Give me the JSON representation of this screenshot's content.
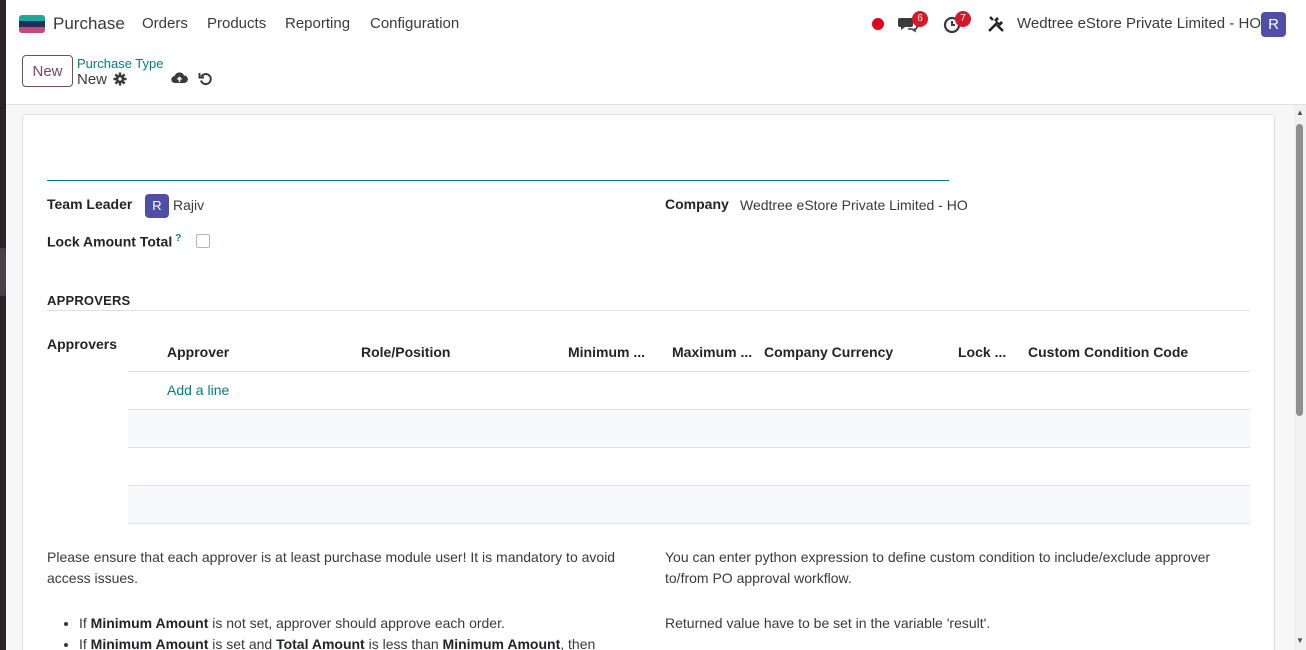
{
  "navbar": {
    "app_name": "Purchase",
    "menu": [
      "Orders",
      "Products",
      "Reporting",
      "Configuration"
    ],
    "messages_count": "6",
    "activities_count": "7",
    "company": "Wedtree eStore Private Limited - HO",
    "user_initial": "R",
    "logo_colors": [
      "#1ea69a",
      "#2a2a5c",
      "#c34a78"
    ]
  },
  "control_panel": {
    "new_label": "New",
    "breadcrumb_parent": "Purchase Type",
    "breadcrumb_current": "New"
  },
  "form": {
    "team_leader_label": "Team Leader",
    "team_leader_initial": "R",
    "team_leader_value": "Rajiv",
    "company_label": "Company",
    "company_value": "Wedtree eStore Private Limited - HO",
    "lock_amount_label": "Lock Amount Total",
    "lock_amount_help": "?",
    "lock_amount_checked": false,
    "section_title": "APPROVERS",
    "approvers_label": "Approvers",
    "columns": [
      "Approver",
      "Role/Position",
      "Minimum ...",
      "Maximum ...",
      "Company Currency",
      "Lock ...",
      "Custom Condition Code"
    ],
    "add_line": "Add a line"
  },
  "help": {
    "left_intro_line1": "Please ensure that each approver is at least purchase module user! It is mandatory to avoid",
    "left_intro_line2": "access issues.",
    "bullet1_pre": "If ",
    "bullet1_bold": "Minimum Amount",
    "bullet1_post": " is not set, approver should approve each order.",
    "bullet2_pre": "If ",
    "bullet2_bold1": "Minimum Amount",
    "bullet2_mid1": " is set and ",
    "bullet2_bold2": "Total Amount",
    "bullet2_mid2": " is less than ",
    "bullet2_bold3": "Minimum Amount",
    "bullet2_post": ", then",
    "right_line1": "You can enter python expression to define custom condition to include/exclude approver",
    "right_line2": "to/from PO approval workflow.",
    "right_line3": "Returned value have to be set in the variable 'result'."
  }
}
